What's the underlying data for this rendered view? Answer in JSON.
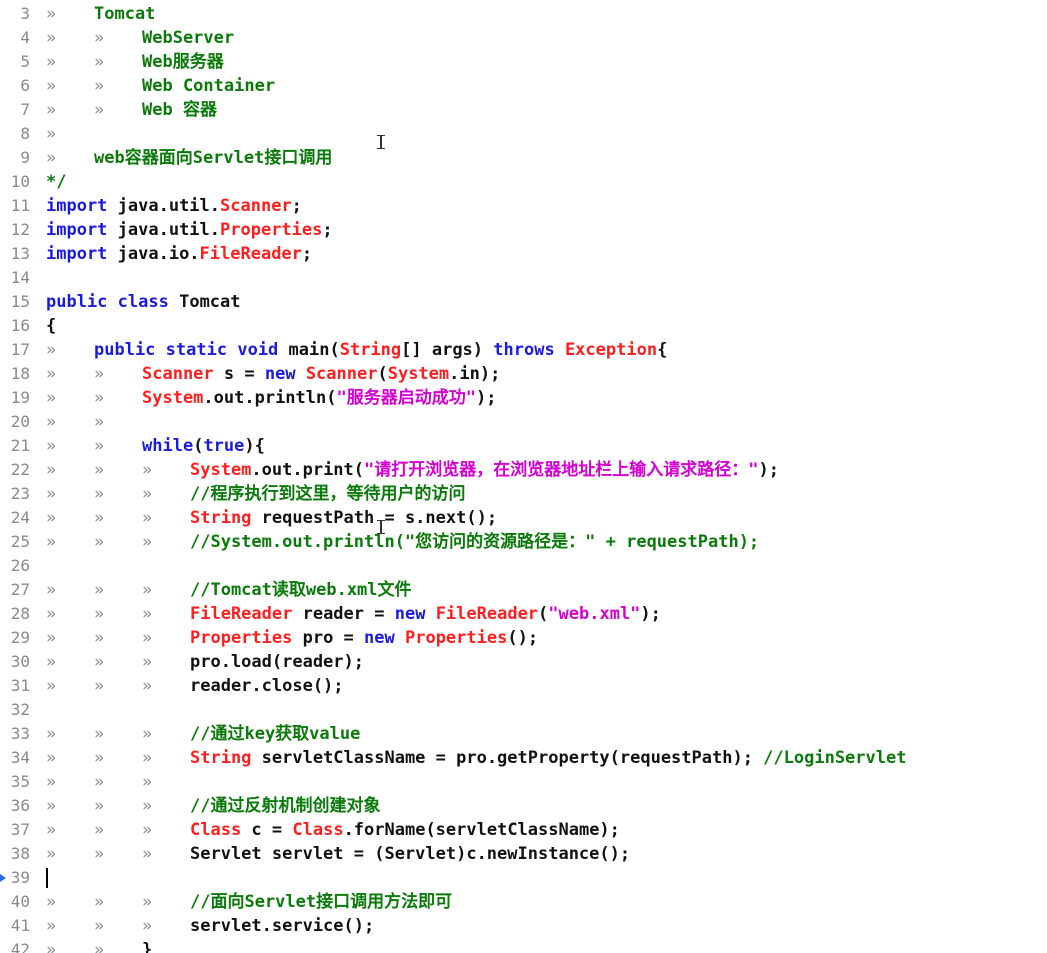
{
  "editor": {
    "tab_glyph": "»",
    "lines": [
      {
        "n": "3",
        "tabs": 1,
        "parts": [
          [
            "cm",
            "Tomcat"
          ]
        ]
      },
      {
        "n": "4",
        "tabs": 2,
        "parts": [
          [
            "cm",
            "WebServer"
          ]
        ]
      },
      {
        "n": "5",
        "tabs": 2,
        "parts": [
          [
            "cm",
            "Web服务器"
          ]
        ]
      },
      {
        "n": "6",
        "tabs": 2,
        "parts": [
          [
            "cm",
            "Web Container"
          ]
        ]
      },
      {
        "n": "7",
        "tabs": 2,
        "parts": [
          [
            "cm",
            "Web 容器"
          ]
        ]
      },
      {
        "n": "8",
        "tabs": 1,
        "parts": []
      },
      {
        "n": "9",
        "tabs": 1,
        "parts": [
          [
            "cm",
            "web容器面向Servlet接口调用"
          ]
        ]
      },
      {
        "n": "10",
        "tabs": 0,
        "parts": [
          [
            "cm",
            "*/"
          ]
        ]
      },
      {
        "n": "11",
        "tabs": 0,
        "parts": [
          [
            "kw",
            "import"
          ],
          [
            "pl",
            " java.util."
          ],
          [
            "cls",
            "Scanner"
          ],
          [
            "pl",
            ";"
          ]
        ]
      },
      {
        "n": "12",
        "tabs": 0,
        "parts": [
          [
            "kw",
            "import"
          ],
          [
            "pl",
            " java.util."
          ],
          [
            "cls",
            "Properties"
          ],
          [
            "pl",
            ";"
          ]
        ]
      },
      {
        "n": "13",
        "tabs": 0,
        "parts": [
          [
            "kw",
            "import"
          ],
          [
            "pl",
            " java.io."
          ],
          [
            "cls",
            "FileReader"
          ],
          [
            "pl",
            ";"
          ]
        ]
      },
      {
        "n": "14",
        "tabs": 0,
        "parts": []
      },
      {
        "n": "15",
        "tabs": 0,
        "parts": [
          [
            "kw",
            "public"
          ],
          [
            "pl",
            " "
          ],
          [
            "kw",
            "class"
          ],
          [
            "pl",
            " Tomcat"
          ]
        ]
      },
      {
        "n": "16",
        "tabs": 0,
        "parts": [
          [
            "pl",
            "{"
          ]
        ]
      },
      {
        "n": "17",
        "tabs": 1,
        "parts": [
          [
            "kw",
            "public"
          ],
          [
            "pl",
            " "
          ],
          [
            "kw",
            "static"
          ],
          [
            "pl",
            " "
          ],
          [
            "kw",
            "void"
          ],
          [
            "pl",
            " main("
          ],
          [
            "cls",
            "String"
          ],
          [
            "pl",
            "[] args) "
          ],
          [
            "kw",
            "throws"
          ],
          [
            "pl",
            " "
          ],
          [
            "cls",
            "Exception"
          ],
          [
            "pl",
            "{"
          ]
        ]
      },
      {
        "n": "18",
        "tabs": 2,
        "parts": [
          [
            "cls",
            "Scanner"
          ],
          [
            "pl",
            " s = "
          ],
          [
            "kw",
            "new"
          ],
          [
            "pl",
            " "
          ],
          [
            "cls",
            "Scanner"
          ],
          [
            "pl",
            "("
          ],
          [
            "cls",
            "System"
          ],
          [
            "pl",
            ".in);"
          ]
        ]
      },
      {
        "n": "19",
        "tabs": 2,
        "parts": [
          [
            "cls",
            "System"
          ],
          [
            "pl",
            ".out.println("
          ],
          [
            "str",
            "\"服务器启动成功\""
          ],
          [
            "pl",
            ");"
          ]
        ]
      },
      {
        "n": "20",
        "tabs": 2,
        "parts": []
      },
      {
        "n": "21",
        "tabs": 2,
        "parts": [
          [
            "kw",
            "while"
          ],
          [
            "pl",
            "("
          ],
          [
            "kw",
            "true"
          ],
          [
            "pl",
            "){"
          ]
        ]
      },
      {
        "n": "22",
        "tabs": 3,
        "parts": [
          [
            "cls",
            "System"
          ],
          [
            "pl",
            ".out.print("
          ],
          [
            "str",
            "\"请打开浏览器，在浏览器地址栏上输入请求路径：\""
          ],
          [
            "pl",
            ");"
          ]
        ]
      },
      {
        "n": "23",
        "tabs": 3,
        "parts": [
          [
            "cm",
            "//程序执行到这里，等待用户的访问"
          ]
        ]
      },
      {
        "n": "24",
        "tabs": 3,
        "parts": [
          [
            "cls",
            "String"
          ],
          [
            "pl",
            " requestPath = s.next();"
          ]
        ]
      },
      {
        "n": "25",
        "tabs": 3,
        "parts": [
          [
            "cm",
            "//System.out.println(\"您访问的资源路径是：\" + requestPath);"
          ]
        ]
      },
      {
        "n": "26",
        "tabs": 0,
        "parts": []
      },
      {
        "n": "27",
        "tabs": 3,
        "parts": [
          [
            "cm",
            "//Tomcat读取web.xml文件"
          ]
        ]
      },
      {
        "n": "28",
        "tabs": 3,
        "parts": [
          [
            "cls",
            "FileReader"
          ],
          [
            "pl",
            " reader = "
          ],
          [
            "kw",
            "new"
          ],
          [
            "pl",
            " "
          ],
          [
            "cls",
            "FileReader"
          ],
          [
            "pl",
            "("
          ],
          [
            "str",
            "\"web.xml\""
          ],
          [
            "pl",
            ");"
          ]
        ]
      },
      {
        "n": "29",
        "tabs": 3,
        "parts": [
          [
            "cls",
            "Properties"
          ],
          [
            "pl",
            " pro = "
          ],
          [
            "kw",
            "new"
          ],
          [
            "pl",
            " "
          ],
          [
            "cls",
            "Properties"
          ],
          [
            "pl",
            "();"
          ]
        ]
      },
      {
        "n": "30",
        "tabs": 3,
        "parts": [
          [
            "pl",
            "pro.load(reader);"
          ]
        ]
      },
      {
        "n": "31",
        "tabs": 3,
        "parts": [
          [
            "pl",
            "reader.close();"
          ]
        ]
      },
      {
        "n": "32",
        "tabs": 0,
        "parts": []
      },
      {
        "n": "33",
        "tabs": 3,
        "parts": [
          [
            "cm",
            "//通过key获取value"
          ]
        ]
      },
      {
        "n": "34",
        "tabs": 3,
        "parts": [
          [
            "cls",
            "String"
          ],
          [
            "pl",
            " servletClassName = pro.getProperty(requestPath); "
          ],
          [
            "cm",
            "//LoginServlet"
          ]
        ]
      },
      {
        "n": "35",
        "tabs": 3,
        "parts": []
      },
      {
        "n": "36",
        "tabs": 3,
        "parts": [
          [
            "cm",
            "//通过反射机制创建对象"
          ]
        ]
      },
      {
        "n": "37",
        "tabs": 3,
        "parts": [
          [
            "cls",
            "Class"
          ],
          [
            "pl",
            " c = "
          ],
          [
            "cls",
            "Class"
          ],
          [
            "pl",
            ".forName(servletClassName);"
          ]
        ]
      },
      {
        "n": "38",
        "tabs": 3,
        "parts": [
          [
            "pl",
            "Servlet servlet = (Servlet)c.newInstance();"
          ]
        ]
      },
      {
        "n": "39",
        "tabs": 0,
        "parts": [],
        "current": true
      },
      {
        "n": "40",
        "tabs": 3,
        "parts": [
          [
            "cm",
            "//面向Servlet接口调用方法即可"
          ]
        ]
      },
      {
        "n": "41",
        "tabs": 3,
        "parts": [
          [
            "pl",
            "servlet.service();"
          ]
        ]
      },
      {
        "n": "42",
        "tabs": 2,
        "parts": [
          [
            "pl",
            "}"
          ]
        ]
      }
    ]
  }
}
